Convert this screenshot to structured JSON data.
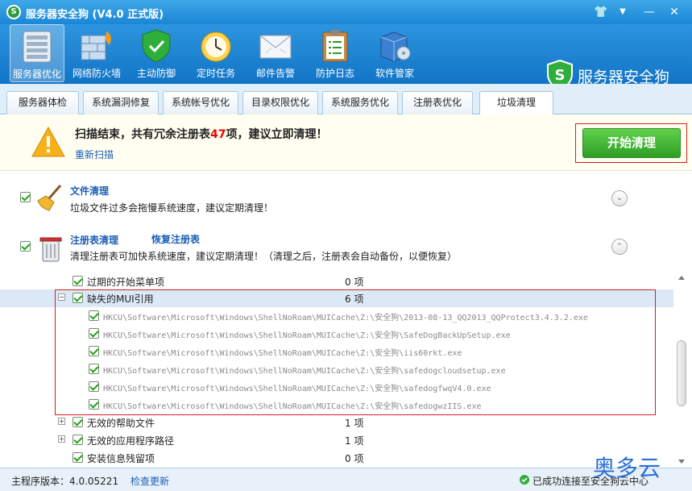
{
  "window": {
    "title": "服务器安全狗 (V4.0 正式版)",
    "logo_letter": "S",
    "buttons": {
      "skin": "👕",
      "menu": "▼",
      "minimize": "—",
      "close": "✕"
    }
  },
  "toolbar": {
    "items": [
      {
        "label": "服务器优化",
        "icon": "server-icon"
      },
      {
        "label": "网络防火墙",
        "icon": "firewall-icon"
      },
      {
        "label": "主动防御",
        "icon": "shield-icon"
      },
      {
        "label": "定时任务",
        "icon": "clock-icon"
      },
      {
        "label": "邮件告警",
        "icon": "mail-icon"
      },
      {
        "label": "防护日志",
        "icon": "clipboard-icon"
      },
      {
        "label": "软件管家",
        "icon": "software-box-icon"
      }
    ],
    "brand": "服务器安全狗",
    "brand_letter": "S"
  },
  "tabs": [
    {
      "label": "服务器体检"
    },
    {
      "label": "系统漏洞修复"
    },
    {
      "label": "系统帐号优化"
    },
    {
      "label": "目录权限优化"
    },
    {
      "label": "系统服务优化"
    },
    {
      "label": "注册表优化"
    },
    {
      "label": "垃圾清理"
    }
  ],
  "notice": {
    "msg_prefix": "扫描结束，共有冗余注册表",
    "count": "47",
    "msg_suffix": "项，建议立即清理！",
    "rescan": "重新扫描",
    "start_button": "开始清理"
  },
  "sections": {
    "file": {
      "title": "文件清理",
      "desc": "垃圾文件过多会拖慢系统速度，建议定期清理！",
      "toggle": "⌄"
    },
    "registry": {
      "title": "注册表清理",
      "restore": "恢复注册表",
      "desc": "清理注册表可加快系统速度，建议定期清理！（清理之后，注册表会自动备份，以便恢复）",
      "toggle": "⌃"
    }
  },
  "tree": {
    "rows": [
      {
        "label": "过期的开始菜单项",
        "count": "0 项"
      },
      {
        "label": "缺失的MUI引用",
        "count": "6 项",
        "expander": "−"
      },
      {
        "path": "HKCU\\Software\\Microsoft\\Windows\\ShellNoRoam\\MUICache\\Z:\\安全狗\\2013-08-13_QQ2013_QQProtect3.4.3.2.exe"
      },
      {
        "path": "HKCU\\Software\\Microsoft\\Windows\\ShellNoRoam\\MUICache\\Z:\\安全狗\\SafeDogBackUpSetup.exe"
      },
      {
        "path": "HKCU\\Software\\Microsoft\\Windows\\ShellNoRoam\\MUICache\\Z:\\安全狗\\iis60rkt.exe"
      },
      {
        "path": "HKCU\\Software\\Microsoft\\Windows\\ShellNoRoam\\MUICache\\Z:\\安全狗\\safedogcloudsetup.exe"
      },
      {
        "path": "HKCU\\Software\\Microsoft\\Windows\\ShellNoRoam\\MUICache\\Z:\\安全狗\\safedogfwqV4.0.exe"
      },
      {
        "path": "HKCU\\Software\\Microsoft\\Windows\\ShellNoRoam\\MUICache\\Z:\\安全狗\\safedogwzIIS.exe"
      },
      {
        "label": "无效的帮助文件",
        "count": "1 项",
        "expander": "+"
      },
      {
        "label": "无效的应用程序路径",
        "count": "1 项",
        "expander": "+"
      },
      {
        "label": "安装信息残留项",
        "count": "0 项"
      }
    ]
  },
  "status": {
    "version": "主程序版本：4.0.05221",
    "update": "检查更新",
    "connection": "已成功连接至安全狗云中心"
  },
  "watermark": "奥多云",
  "colors": {
    "accent": "#1a86d6",
    "danger": "#d21f1f",
    "ok": "#2e9e24",
    "link": "#1c5fb6"
  }
}
